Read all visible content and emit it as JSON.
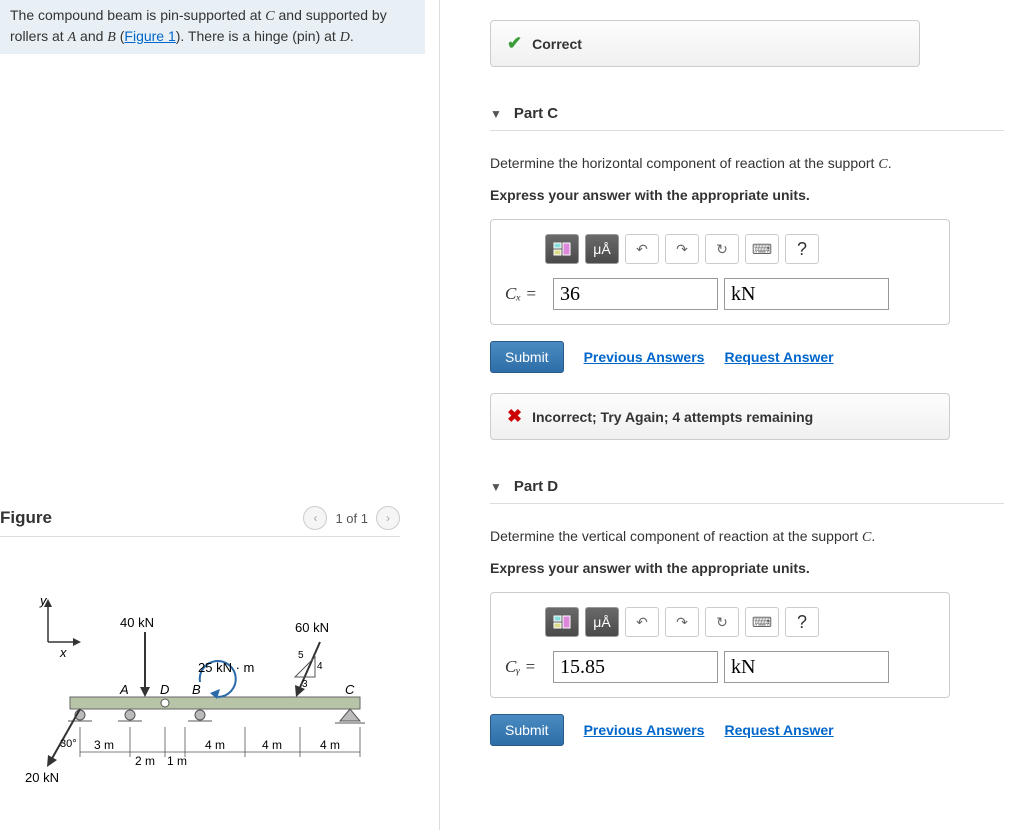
{
  "problem": {
    "text_before_C": "The compound beam is pin-supported at ",
    "C": "C",
    "text_after_C": " and supported by rollers at ",
    "A": "A",
    "text_and": " and ",
    "B": "B",
    "text_fig_open": " (",
    "figure_link": "Figure 1",
    "text_fig_close": "). There is a hinge (pin) at ",
    "D": "D",
    "text_end": "."
  },
  "figure": {
    "title": "Figure",
    "counter": "1 of 1",
    "labels": {
      "y": "y",
      "x": "x",
      "force40": "40 kN",
      "force60": "60 kN",
      "moment": "25 kN · m",
      "A": "A",
      "D": "D",
      "B": "B",
      "C": "C",
      "angle30": "30°",
      "force20": "20 kN",
      "d3m": "3 m",
      "d2m": "2 m",
      "d1m": "1 m",
      "d4m": "4 m",
      "ratio5": "5",
      "ratio4": "4",
      "ratio3": "3"
    }
  },
  "correctBox": {
    "label": "Correct"
  },
  "partC": {
    "title": "Part C",
    "prompt_before": "Determine the horizontal component of reaction at the support ",
    "prompt_var": "C",
    "prompt_after": ".",
    "hint": "Express your answer with the appropriate units.",
    "toolbar": {
      "templates": "templates-icon",
      "units": "μÅ",
      "undo": "undo",
      "redo": "redo",
      "reset": "reset",
      "keyboard": "keyboard",
      "help": "?"
    },
    "var_label": "Cₓ =",
    "value": "36",
    "unit": "kN",
    "submit": "Submit",
    "prev": "Previous Answers",
    "req": "Request Answer",
    "feedback": "Incorrect; Try Again; 4 attempts remaining"
  },
  "partD": {
    "title": "Part D",
    "prompt_before": "Determine the vertical component of reaction at the support ",
    "prompt_var": "C",
    "prompt_after": ".",
    "hint": "Express your answer with the appropriate units.",
    "var_label": "Cᵧ =",
    "value": "15.85",
    "unit": "kN",
    "submit": "Submit",
    "prev": "Previous Answers",
    "req": "Request Answer"
  }
}
